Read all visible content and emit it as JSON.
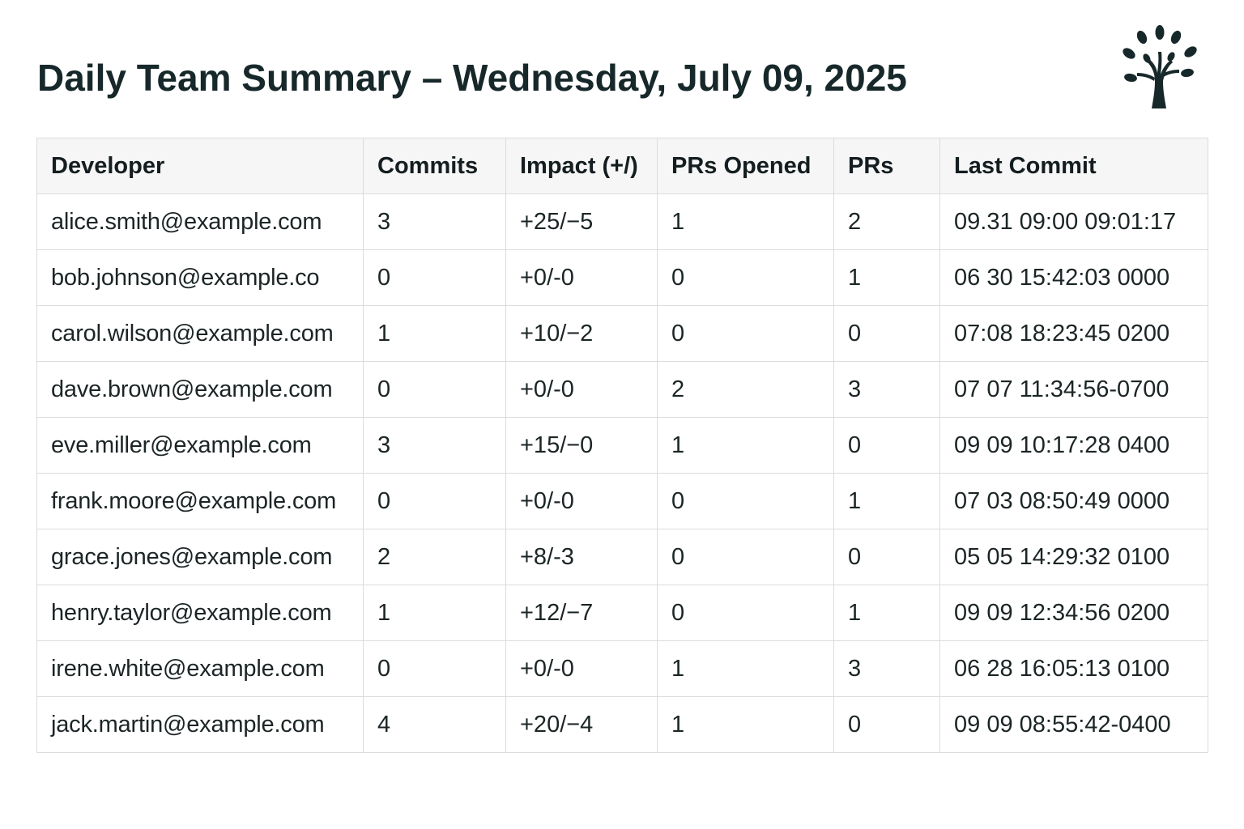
{
  "header": {
    "title": "Daily Team Summary – Wednesday, July 09, 2025",
    "logo_icon": "tree-icon",
    "logo_color": "#17282a"
  },
  "table": {
    "columns": [
      "Developer",
      "Commits",
      "Impact (+/)",
      "PRs Opened",
      "PRs",
      "Last Commit"
    ],
    "rows": [
      {
        "developer": "alice.smith@example.com",
        "commits": "3",
        "impact": "+25/−5",
        "prs_opened": "1",
        "prs": "2",
        "last_commit": "09.31 09:00 09:01:17"
      },
      {
        "developer": "bob.johnson@example.co",
        "commits": "0",
        "impact": "+0/-0",
        "prs_opened": "0",
        "prs": "1",
        "last_commit": "06 30 15:42:03 0000"
      },
      {
        "developer": "carol.wilson@example.com",
        "commits": "1",
        "impact": "+10/−2",
        "prs_opened": "0",
        "prs": "0",
        "last_commit": "07:08 18:23:45 0200"
      },
      {
        "developer": "dave.brown@example.com",
        "commits": "0",
        "impact": "+0/-0",
        "prs_opened": "2",
        "prs": "3",
        "last_commit": "07 07 11:34:56-0700"
      },
      {
        "developer": "eve.miller@example.com",
        "commits": "3",
        "impact": "+15/−0",
        "prs_opened": "1",
        "prs": "0",
        "last_commit": "09 09 10:17:28 0400"
      },
      {
        "developer": "frank.moore@example.com",
        "commits": "0",
        "impact": "+0/-0",
        "prs_opened": "0",
        "prs": "1",
        "last_commit": "07 03 08:50:49 0000"
      },
      {
        "developer": "grace.jones@example.com",
        "commits": "2",
        "impact": "+8/-3",
        "prs_opened": "0",
        "prs": "0",
        "last_commit": "05 05 14:29:32 0100"
      },
      {
        "developer": "henry.taylor@example.com",
        "commits": "1",
        "impact": "+12/−7",
        "prs_opened": "0",
        "prs": "1",
        "last_commit": "09 09 12:34:56 0200"
      },
      {
        "developer": "irene.white@example.com",
        "commits": "0",
        "impact": "+0/-0",
        "prs_opened": "1",
        "prs": "3",
        "last_commit": "06 28 16:05:13 0100"
      },
      {
        "developer": "jack.martin@example.com",
        "commits": "4",
        "impact": "+20/−4",
        "prs_opened": "1",
        "prs": "0",
        "last_commit": "09 09 08:55:42-0400"
      }
    ]
  }
}
